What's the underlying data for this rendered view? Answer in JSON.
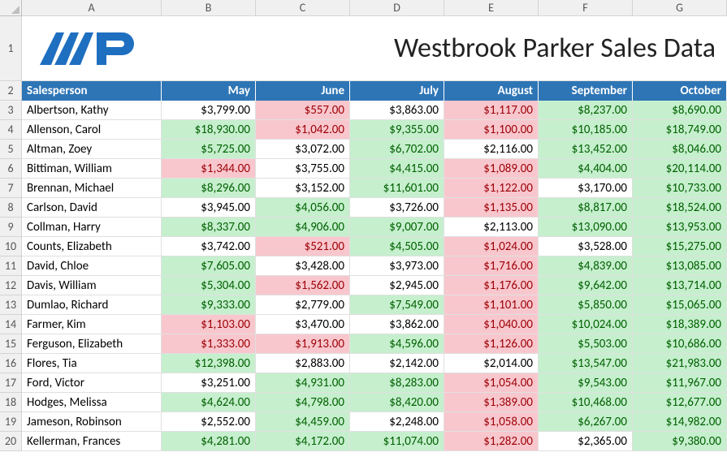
{
  "title": "Westbrook Parker Sales Data",
  "columns_letters": [
    "A",
    "B",
    "C",
    "D",
    "E",
    "F",
    "G"
  ],
  "headers": [
    "Salesperson",
    "May",
    "June",
    "July",
    "August",
    "September",
    "October"
  ],
  "chart_data": {
    "type": "table",
    "columns": [
      "Salesperson",
      "May",
      "June",
      "July",
      "August",
      "September",
      "October"
    ],
    "rows": [
      {
        "name": "Albertson, Kathy",
        "v": [
          "$3,799.00",
          "$557.00",
          "$3,863.00",
          "$1,117.00",
          "$8,237.00",
          "$8,690.00"
        ],
        "c": [
          "",
          "red",
          "",
          "red",
          "green",
          "green"
        ]
      },
      {
        "name": "Allenson, Carol",
        "v": [
          "$18,930.00",
          "$1,042.00",
          "$9,355.00",
          "$1,100.00",
          "$10,185.00",
          "$18,749.00"
        ],
        "c": [
          "green",
          "red",
          "green",
          "red",
          "green",
          "green"
        ]
      },
      {
        "name": "Altman, Zoey",
        "v": [
          "$5,725.00",
          "$3,072.00",
          "$6,702.00",
          "$2,116.00",
          "$13,452.00",
          "$8,046.00"
        ],
        "c": [
          "green",
          "",
          "green",
          "",
          "green",
          "green"
        ]
      },
      {
        "name": "Bittiman, William",
        "v": [
          "$1,344.00",
          "$3,755.00",
          "$4,415.00",
          "$1,089.00",
          "$4,404.00",
          "$20,114.00"
        ],
        "c": [
          "red",
          "",
          "green",
          "red",
          "green",
          "green"
        ]
      },
      {
        "name": "Brennan, Michael",
        "v": [
          "$8,296.00",
          "$3,152.00",
          "$11,601.00",
          "$1,122.00",
          "$3,170.00",
          "$10,733.00"
        ],
        "c": [
          "green",
          "",
          "green",
          "red",
          "",
          "green"
        ]
      },
      {
        "name": "Carlson, David",
        "v": [
          "$3,945.00",
          "$4,056.00",
          "$3,726.00",
          "$1,135.00",
          "$8,817.00",
          "$18,524.00"
        ],
        "c": [
          "",
          "green",
          "",
          "red",
          "green",
          "green"
        ]
      },
      {
        "name": "Collman, Harry",
        "v": [
          "$8,337.00",
          "$4,906.00",
          "$9,007.00",
          "$2,113.00",
          "$13,090.00",
          "$13,953.00"
        ],
        "c": [
          "green",
          "green",
          "green",
          "",
          "green",
          "green"
        ]
      },
      {
        "name": "Counts, Elizabeth",
        "v": [
          "$3,742.00",
          "$521.00",
          "$4,505.00",
          "$1,024.00",
          "$3,528.00",
          "$15,275.00"
        ],
        "c": [
          "",
          "red",
          "green",
          "red",
          "",
          "green"
        ]
      },
      {
        "name": "David, Chloe",
        "v": [
          "$7,605.00",
          "$3,428.00",
          "$3,973.00",
          "$1,716.00",
          "$4,839.00",
          "$13,085.00"
        ],
        "c": [
          "green",
          "",
          "",
          "red",
          "green",
          "green"
        ]
      },
      {
        "name": "Davis, William",
        "v": [
          "$5,304.00",
          "$1,562.00",
          "$2,945.00",
          "$1,176.00",
          "$9,642.00",
          "$13,714.00"
        ],
        "c": [
          "green",
          "red",
          "",
          "red",
          "green",
          "green"
        ]
      },
      {
        "name": "Dumlao, Richard",
        "v": [
          "$9,333.00",
          "$2,779.00",
          "$7,549.00",
          "$1,101.00",
          "$5,850.00",
          "$15,065.00"
        ],
        "c": [
          "green",
          "",
          "green",
          "red",
          "green",
          "green"
        ]
      },
      {
        "name": "Farmer, Kim",
        "v": [
          "$1,103.00",
          "$3,470.00",
          "$3,862.00",
          "$1,040.00",
          "$10,024.00",
          "$18,389.00"
        ],
        "c": [
          "red",
          "",
          "",
          "red",
          "green",
          "green"
        ]
      },
      {
        "name": "Ferguson, Elizabeth",
        "v": [
          "$1,333.00",
          "$1,913.00",
          "$4,596.00",
          "$1,126.00",
          "$5,503.00",
          "$10,686.00"
        ],
        "c": [
          "red",
          "red",
          "green",
          "red",
          "green",
          "green"
        ]
      },
      {
        "name": "Flores, Tia",
        "v": [
          "$12,398.00",
          "$2,883.00",
          "$2,142.00",
          "$2,014.00",
          "$13,547.00",
          "$21,983.00"
        ],
        "c": [
          "green",
          "",
          "",
          "",
          "green",
          "green"
        ]
      },
      {
        "name": "Ford, Victor",
        "v": [
          "$3,251.00",
          "$4,931.00",
          "$8,283.00",
          "$1,054.00",
          "$9,543.00",
          "$11,967.00"
        ],
        "c": [
          "",
          "green",
          "green",
          "red",
          "green",
          "green"
        ]
      },
      {
        "name": "Hodges, Melissa",
        "v": [
          "$4,624.00",
          "$4,798.00",
          "$8,420.00",
          "$1,389.00",
          "$10,468.00",
          "$12,677.00"
        ],
        "c": [
          "green",
          "green",
          "green",
          "red",
          "green",
          "green"
        ]
      },
      {
        "name": "Jameson, Robinson",
        "v": [
          "$2,552.00",
          "$4,459.00",
          "$2,248.00",
          "$1,058.00",
          "$6,267.00",
          "$14,982.00"
        ],
        "c": [
          "",
          "green",
          "",
          "red",
          "green",
          "green"
        ]
      },
      {
        "name": "Kellerman, Frances",
        "v": [
          "$4,281.00",
          "$4,172.00",
          "$11,074.00",
          "$1,282.00",
          "$2,365.00",
          "$9,380.00"
        ],
        "c": [
          "green",
          "green",
          "green",
          "red",
          "",
          "green"
        ]
      }
    ]
  },
  "colors": {
    "green_bg": "#c6efce",
    "green_fg": "#006100",
    "red_bg": "#f8c7cd",
    "red_fg": "#9c0006",
    "header_bg": "#2e75b6",
    "brand": "#1f6fc0"
  }
}
